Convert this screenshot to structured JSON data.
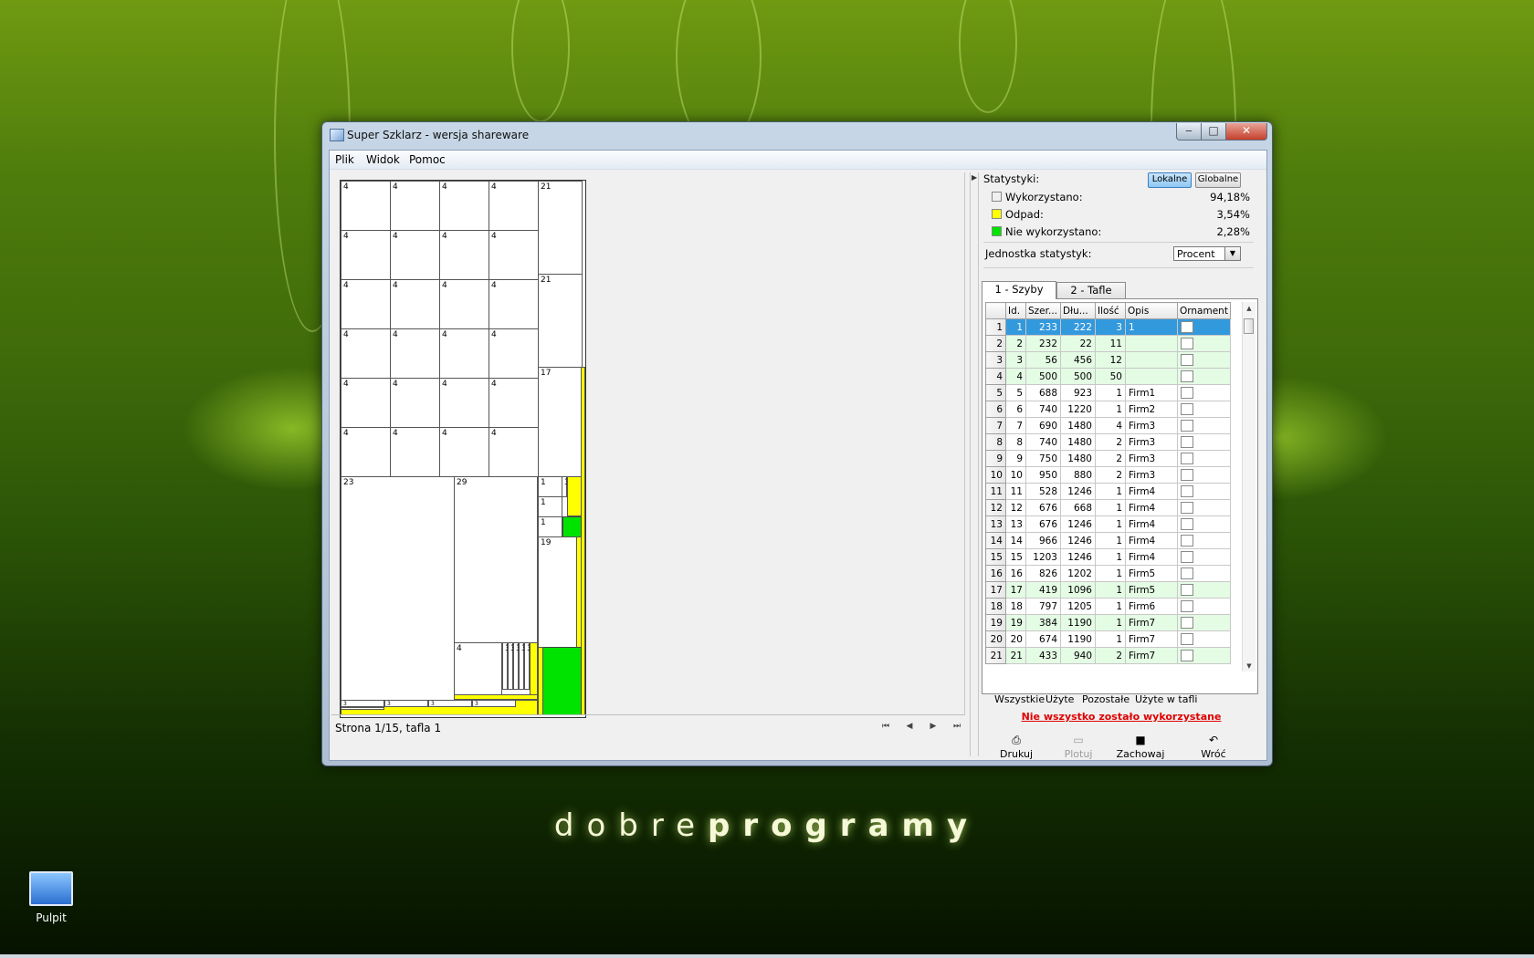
{
  "window": {
    "title": "Super Szklarz - wersja shareware",
    "minimize": "‒",
    "maximize": "□",
    "close": "✕"
  },
  "menu": [
    "Plik",
    "Widok",
    "Pomoc"
  ],
  "pieces": [
    {
      "label": "4"
    },
    {
      "label": "4"
    },
    {
      "label": "4"
    },
    {
      "label": "4"
    },
    {
      "label": "4"
    },
    {
      "label": "4"
    },
    {
      "label": "4"
    },
    {
      "label": "4"
    },
    {
      "label": "4"
    },
    {
      "label": "4"
    },
    {
      "label": "4"
    },
    {
      "label": "4"
    },
    {
      "label": "4"
    },
    {
      "label": "4"
    },
    {
      "label": "4"
    },
    {
      "label": "4"
    },
    {
      "label": "4"
    },
    {
      "label": "4"
    },
    {
      "label": "4"
    },
    {
      "label": "4"
    },
    {
      "label": "4"
    },
    {
      "label": "4"
    },
    {
      "label": "4"
    },
    {
      "label": "4"
    },
    {
      "label": "21"
    },
    {
      "label": "21"
    },
    {
      "label": "17"
    },
    {
      "label": "23"
    },
    {
      "label": "29"
    },
    {
      "label": "4"
    },
    {
      "label": "1"
    },
    {
      "label": "1"
    },
    {
      "label": "1"
    },
    {
      "label": "19"
    },
    {
      "label": "3"
    },
    {
      "label": "3"
    },
    {
      "label": "3"
    },
    {
      "label": "3"
    },
    {
      "label": "3"
    },
    {
      "label": "3"
    },
    {
      "label": "3"
    },
    {
      "label": "3"
    },
    {
      "label": "3"
    },
    {
      "label": "3"
    }
  ],
  "status": {
    "page": "Strona 1/15, tafla 1"
  },
  "nav": {
    "first": "⏮",
    "prev": "◀",
    "next": "▶",
    "last": "⏭"
  },
  "stats": {
    "title": "Statystyki:",
    "local": "Lokalne",
    "global": "Globalne",
    "used_label": "Wykorzystano:",
    "used_value": "94,18%",
    "waste_label": "Odpad:",
    "waste_value": "3,54%",
    "unused_label": "Nie wykorzystano:",
    "unused_value": "2,28%",
    "colors": {
      "used": "#f0f0f0",
      "waste": "#ffff00",
      "unused": "#00e300"
    }
  },
  "unit": {
    "label": "Jednostka statystyk:",
    "value": "Procent"
  },
  "tabs": [
    "1 - Szyby",
    "2 - Tafle"
  ],
  "grid": {
    "columns": [
      "Id.",
      "Szer...",
      "Dłu...",
      "Ilość",
      "Opis",
      "Ornament"
    ],
    "rows": [
      [
        "1",
        "1",
        "233",
        "222",
        "3",
        "1"
      ],
      [
        "2",
        "2",
        "232",
        "22",
        "11",
        ""
      ],
      [
        "3",
        "3",
        "56",
        "456",
        "12",
        ""
      ],
      [
        "4",
        "4",
        "500",
        "500",
        "50",
        ""
      ],
      [
        "5",
        "5",
        "688",
        "923",
        "1",
        "Firm1"
      ],
      [
        "6",
        "6",
        "740",
        "1220",
        "1",
        "Firm2"
      ],
      [
        "7",
        "7",
        "690",
        "1480",
        "4",
        "Firm3"
      ],
      [
        "8",
        "8",
        "740",
        "1480",
        "2",
        "Firm3"
      ],
      [
        "9",
        "9",
        "750",
        "1480",
        "2",
        "Firm3"
      ],
      [
        "10",
        "10",
        "950",
        "880",
        "2",
        "Firm3"
      ],
      [
        "11",
        "11",
        "528",
        "1246",
        "1",
        "Firm4"
      ],
      [
        "12",
        "12",
        "676",
        "668",
        "1",
        "Firm4"
      ],
      [
        "13",
        "13",
        "676",
        "1246",
        "1",
        "Firm4"
      ],
      [
        "14",
        "14",
        "966",
        "1246",
        "1",
        "Firm4"
      ],
      [
        "15",
        "15",
        "1203",
        "1246",
        "1",
        "Firm4"
      ],
      [
        "16",
        "16",
        "826",
        "1202",
        "1",
        "Firm5"
      ],
      [
        "17",
        "17",
        "419",
        "1096",
        "1",
        "Firm5"
      ],
      [
        "18",
        "18",
        "797",
        "1205",
        "1",
        "Firm6"
      ],
      [
        "19",
        "19",
        "384",
        "1190",
        "1",
        "Firm7"
      ],
      [
        "20",
        "20",
        "674",
        "1190",
        "1",
        "Firm7"
      ],
      [
        "21",
        "21",
        "433",
        "940",
        "2",
        "Firm7"
      ]
    ]
  },
  "subtabs": [
    "Wszystkie",
    "Użyte",
    "Pozostałe",
    "Użyte w tafli"
  ],
  "warning": "Nie wszystko zostało wykorzystane",
  "toolbar": {
    "print": "Drukuj",
    "plot": "Plotuj",
    "save": "Zachowaj",
    "back": "Wróć"
  },
  "desktop": {
    "icon_label": "Pulpit",
    "brand_light": "dobre",
    "brand_bold": "programy"
  }
}
